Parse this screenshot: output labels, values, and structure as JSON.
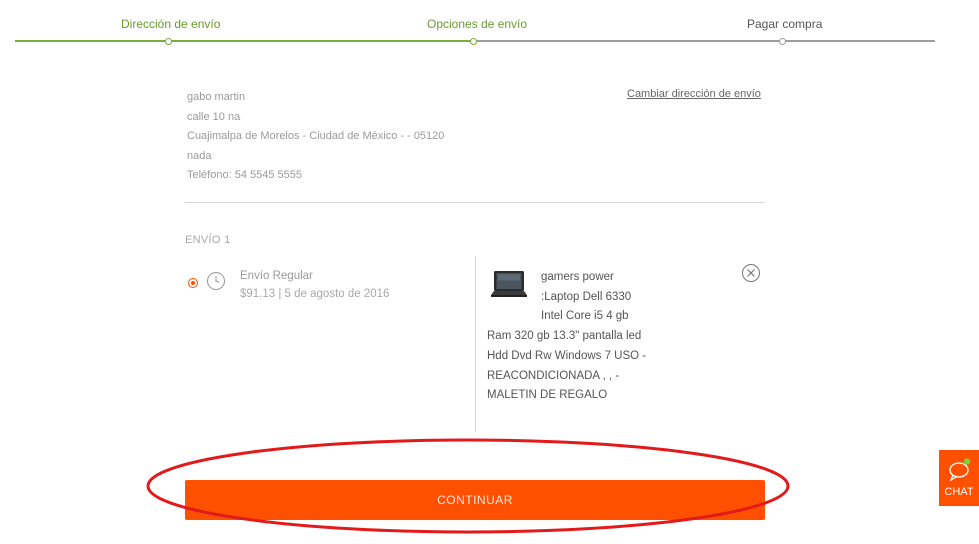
{
  "stepper": {
    "steps": [
      {
        "label": "Dirección de envío",
        "status": "done"
      },
      {
        "label": "Opciones de envío",
        "status": "current"
      },
      {
        "label": "Pagar compra",
        "status": "pending"
      }
    ]
  },
  "address": {
    "name": "gabo martin",
    "street": "calle 10 na",
    "city": "Cuajimalpa de Morelos - Ciudad de México - - 05120",
    "reference": "nada",
    "phone_label": "Teléfono:",
    "phone": "54 5545 5555",
    "change_link": "Cambiar dirección de envío"
  },
  "shipment": {
    "title": "ENVÍO 1",
    "option": {
      "name": "Envío Regular",
      "detail": "$91.13 | 5 de agosto de 2016",
      "selected": true
    },
    "product": {
      "line1": "gamers power",
      "line2": ":Laptop Dell 6330",
      "line3": "Intel Core i5 4 gb",
      "line4": "Ram 320 gb 13.3\" pantalla led",
      "line5": "Hdd Dvd Rw Windows 7 USO -",
      "line6": "REACONDICIONADA , , -",
      "line7": "MALETIN DE REGALO"
    }
  },
  "actions": {
    "continue_label": "CONTINUAR"
  },
  "chat": {
    "label": "CHAT"
  },
  "colors": {
    "accent": "#ff5000",
    "step_done": "#7bab3c",
    "annotation": "#e31a1a"
  }
}
